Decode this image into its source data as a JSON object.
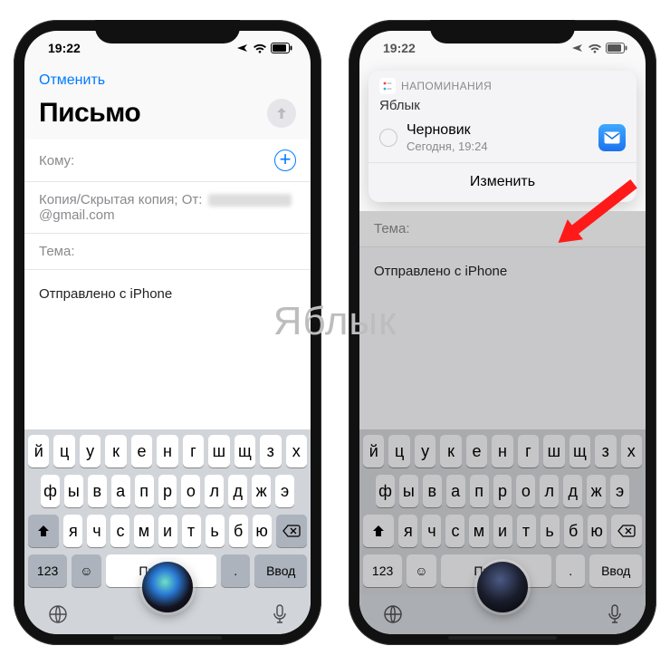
{
  "watermark": "Яблык",
  "status": {
    "time": "19:22"
  },
  "left": {
    "cancel": "Отменить",
    "heading": "Письмо",
    "to_label": "Кому:",
    "cc_label": "Копия/Скрытая копия; От:",
    "cc_domain": "@gmail.com",
    "subject_label": "Тема:",
    "body_text": "Отправлено с iPhone"
  },
  "right": {
    "notif_app": "НАПОМИНАНИЯ",
    "notif_list": "Яблык",
    "notif_item_title": "Черновик",
    "notif_item_sub": "Сегодня, 19:24",
    "notif_action": "Изменить",
    "subject_label": "Тема:",
    "body_text": "Отправлено с iPhone"
  },
  "keyboard": {
    "row1": [
      "й",
      "ц",
      "у",
      "к",
      "е",
      "н",
      "г",
      "ш",
      "щ",
      "з",
      "х"
    ],
    "row2": [
      "ф",
      "ы",
      "в",
      "а",
      "п",
      "р",
      "о",
      "л",
      "д",
      "ж",
      "э"
    ],
    "row3": [
      "я",
      "ч",
      "с",
      "м",
      "и",
      "т",
      "ь",
      "б",
      "ю"
    ],
    "numkey": "123",
    "space": "Пробел",
    "enter": "Ввод",
    "dot": "."
  }
}
